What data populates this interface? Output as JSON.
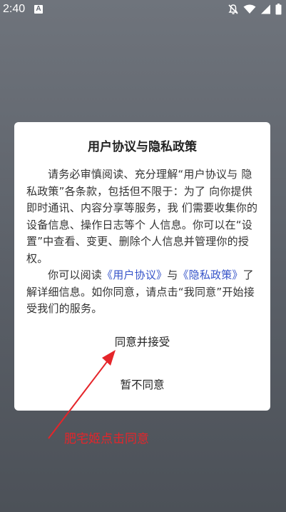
{
  "status_bar": {
    "time": "2:40",
    "badge": "A",
    "icons": [
      "bell-off-icon",
      "wifi-icon",
      "signal-icon",
      "battery-icon"
    ]
  },
  "dialog": {
    "title": "用户协议与隐私政策",
    "para1": "请务必审慎阅读、充分理解“用户协议与 隐私政策”各条款，包括但不限于：为了 向你提供即时通讯、内容分享等服务，我 们需要收集你的设备信息、操作日志等个 人信息。你可以在“设置”中查看、变更、删除个人信息并管理你的授权。",
    "para2_prefix": "你可以阅读",
    "link_user_agreement": "《用户协议》",
    "para2_and": "与",
    "link_privacy_policy": "《隐私政策》",
    "para2_suffix": "了解详细信息。如你同意，请点击“我同意”开始接受我们的服务。",
    "agree_button": "同意并接受",
    "decline_button": "暂不同意"
  },
  "annotation": {
    "text": "肥宅姬点击同意",
    "color": "#e5252a"
  }
}
